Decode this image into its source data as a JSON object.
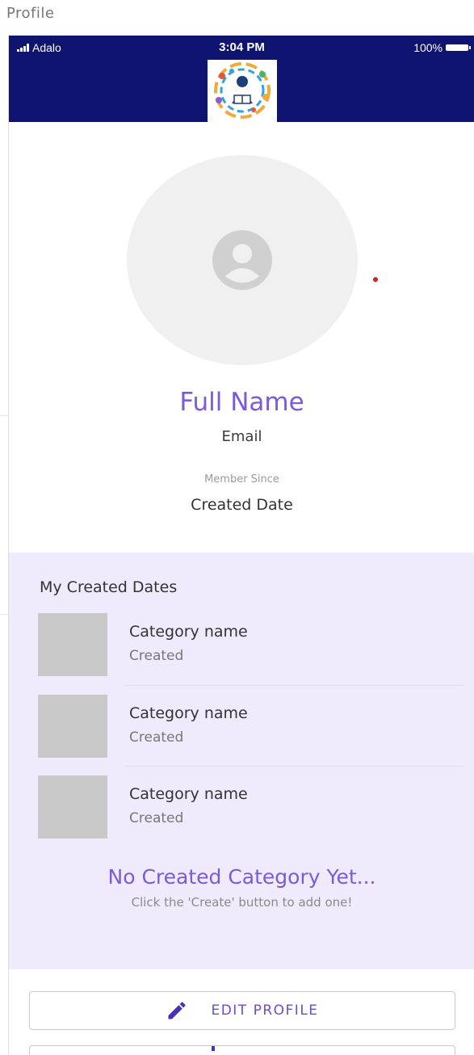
{
  "screen": {
    "title": "Profile"
  },
  "status_bar": {
    "carrier": "Adalo",
    "time": "3:04 PM",
    "battery": "100%"
  },
  "profile": {
    "full_name": "Full Name",
    "email": "Email",
    "member_since_label": "Member Since",
    "created_date": "Created Date"
  },
  "created_section": {
    "title": "My Created Dates",
    "items": [
      {
        "title": "Category name",
        "subtitle": "Created"
      },
      {
        "title": "Category name",
        "subtitle": "Created"
      },
      {
        "title": "Category name",
        "subtitle": "Created"
      }
    ],
    "empty_title": "No Created Category Yet...",
    "empty_subtitle": "Click the 'Create' button to add one!"
  },
  "actions": {
    "edit_profile": "EDIT PROFILE"
  },
  "colors": {
    "header_bg": "#0f1470",
    "accent": "#7b5bd6",
    "section_bg": "#efebfc"
  }
}
